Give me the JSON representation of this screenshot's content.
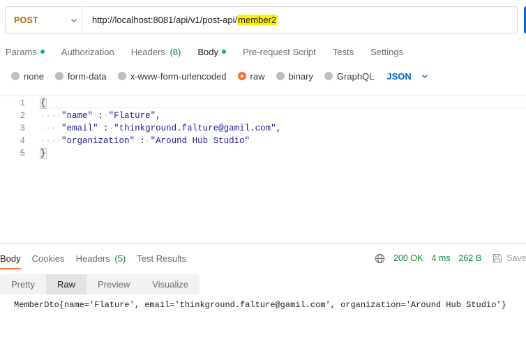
{
  "request": {
    "method": "POST",
    "url_prefix": "http://localhost:8081/api/v1/post-api/",
    "url_highlight": "member2"
  },
  "request_tabs": [
    {
      "label": "Params",
      "dot": true
    },
    {
      "label": "Authorization"
    },
    {
      "label": "Headers",
      "count": "(8)"
    },
    {
      "label": "Body",
      "dot": true,
      "active": true
    },
    {
      "label": "Pre-request Script"
    },
    {
      "label": "Tests"
    },
    {
      "label": "Settings"
    }
  ],
  "body_types": [
    {
      "label": "none"
    },
    {
      "label": "form-data"
    },
    {
      "label": "x-www-form-urlencoded"
    },
    {
      "label": "raw",
      "selected": true
    },
    {
      "label": "binary"
    },
    {
      "label": "GraphQL"
    }
  ],
  "format_select": "JSON",
  "editor": {
    "line_numbers": [
      "1",
      "2",
      "3",
      "4",
      "5"
    ],
    "open_brace": "{",
    "close_brace": "}",
    "fields": [
      {
        "key": "\"name\"",
        "value": "\"Flature\"",
        "comma": ","
      },
      {
        "key": "\"email\"",
        "value": "\"thinkground.falture@gamil.com\"",
        "comma": ","
      },
      {
        "key": "\"organization\"",
        "value": "\"Around Hub Studio\"",
        "comma": ""
      }
    ]
  },
  "response_tabs": [
    {
      "label": "Body",
      "active": true
    },
    {
      "label": "Cookies"
    },
    {
      "label": "Headers",
      "count": "(5)"
    },
    {
      "label": "Test Results"
    }
  ],
  "response_status": {
    "status": "200 OK",
    "time": "4 ms",
    "size": "262 B",
    "save_label": "Save"
  },
  "view_tabs": [
    {
      "label": "Pretty"
    },
    {
      "label": "Raw",
      "active": true
    },
    {
      "label": "Preview"
    },
    {
      "label": "Visualize"
    }
  ],
  "response_body": "MemberDto{name='Flature', email='thinkground.falture@gamil.com', organization='Around Hub Studio'}",
  "colors": {
    "method": "#b56a00",
    "accent": "#ff6c37",
    "link_blue": "#0265d2",
    "success_green": "#0c8a3a",
    "highlight": "#fff200"
  }
}
